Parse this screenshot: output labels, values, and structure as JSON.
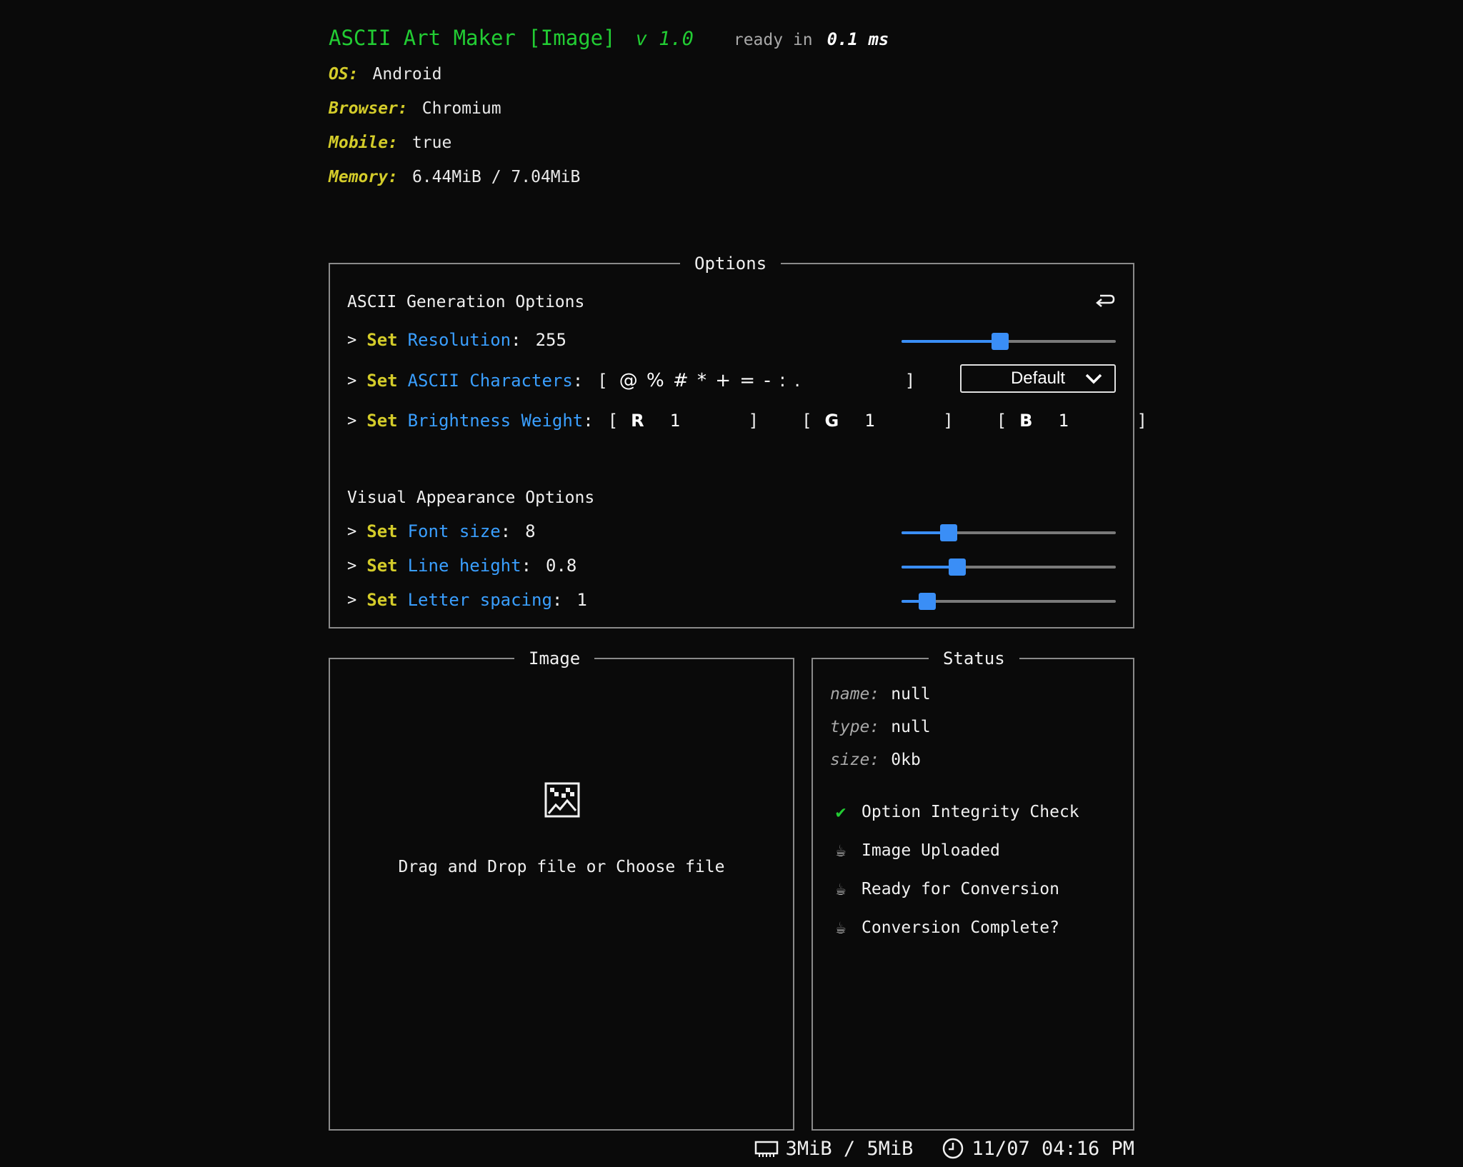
{
  "header": {
    "title": "ASCII Art Maker [Image]",
    "version": "v 1.0",
    "ready_label": "ready in",
    "ready_value": "0.1 ms",
    "info": [
      {
        "key": "OS:",
        "value": "Android"
      },
      {
        "key": "Browser:",
        "value": "Chromium"
      },
      {
        "key": "Mobile:",
        "value": "true"
      },
      {
        "key": "Memory:",
        "value": "6.44MiB / 7.04MiB"
      }
    ]
  },
  "options": {
    "legend": "Options",
    "generation_title": "ASCII Generation Options",
    "reset_icon": "reset-icon",
    "prefix": ">",
    "set_keyword": "Set",
    "resolution": {
      "label": "Resolution",
      "value": "255",
      "fraction": 0.46
    },
    "ascii_chars": {
      "label": "ASCII Characters",
      "value": "@ % # * + = - : .",
      "preset": "Default"
    },
    "brightness": {
      "label": "Brightness Weight",
      "r_label": "R",
      "r_value": "1",
      "g_label": "G",
      "g_value": "1",
      "b_label": "B",
      "b_value": "1"
    },
    "visual_title": "Visual Appearance Options",
    "font_size": {
      "label": "Font size",
      "value": "8",
      "fraction": 0.22
    },
    "line_height": {
      "label": "Line height",
      "value": "0.8",
      "fraction": 0.26
    },
    "letter_spacing": {
      "label": "Letter spacing",
      "value": "1",
      "fraction": 0.12
    }
  },
  "image_panel": {
    "legend": "Image",
    "drop_text": "Drag and Drop file or Choose file",
    "icon": "image-placeholder-icon"
  },
  "status_panel": {
    "legend": "Status",
    "name_key": "name:",
    "name_value": "null",
    "type_key": "type:",
    "type_value": "null",
    "size_key": "size:",
    "size_value": "0kb",
    "checks": [
      {
        "label": "Option Integrity Check",
        "state": "done",
        "icon": "✔"
      },
      {
        "label": "Image Uploaded",
        "state": "pending",
        "icon": "☕"
      },
      {
        "label": "Ready for Conversion",
        "state": "pending",
        "icon": "☕"
      },
      {
        "label": "Conversion Complete?",
        "state": "pending",
        "icon": "☕"
      }
    ]
  },
  "footer": {
    "memory": "3MiB / 5MiB",
    "datetime": "11/07 04:16 PM"
  },
  "colors": {
    "background": "#0a0a0a",
    "title_green": "#22cc33",
    "key_yellow": "#d4cc2a",
    "accent_blue": "#3a9fff",
    "slider_blue": "#3a8ef6",
    "border_gray": "#8a8a8a"
  }
}
